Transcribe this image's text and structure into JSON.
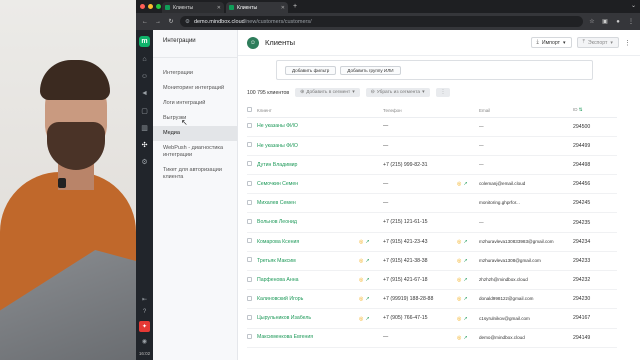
{
  "browser": {
    "tabs": [
      {
        "label": "Клиенты",
        "active": false
      },
      {
        "label": "Клиенты",
        "active": true
      }
    ],
    "url_host": "demo.mindbox.cloud",
    "url_path": "/new/customers/customers/"
  },
  "rail": {
    "logo": "m",
    "bottom_time": "16:02"
  },
  "submenu": {
    "title": "Интеграции",
    "items": [
      {
        "label": "Интеграции",
        "active": false
      },
      {
        "label": "Мониторинг интеграций",
        "active": false
      },
      {
        "label": "Логи интеграций",
        "active": false
      },
      {
        "label": "Выгрузки",
        "active": false
      },
      {
        "label": "Медиа",
        "active": true
      },
      {
        "label": "WebPush - диагностика интеграции",
        "active": false
      },
      {
        "label": "Тикет для авторизации клиента",
        "active": false
      }
    ]
  },
  "page": {
    "title": "Клиенты",
    "import_label": "Импорт",
    "export_label": "Экспорт",
    "add_filter": "Добавить фильтр",
    "add_group": "Добавить группу ИЛИ",
    "count": "100 795 клиентов",
    "add_segment": "Добавить в сегмент",
    "remove_segment": "Убрать из сегмента"
  },
  "table": {
    "headers": {
      "client": "Клиент",
      "phone": "Телефон",
      "email": "Email",
      "id": "ID"
    },
    "rows": [
      {
        "name": "Не указаны ФИО",
        "icons": false,
        "phone": "—",
        "phone_icons": false,
        "email": "—",
        "id": "294500"
      },
      {
        "name": "Не указаны ФИО",
        "icons": false,
        "phone": "—",
        "phone_icons": false,
        "email": "—",
        "id": "294499"
      },
      {
        "name": "Дутин Владимир",
        "icons": false,
        "phone": "+7 (215) 999-82-31",
        "phone_icons": false,
        "email": "—",
        "id": "294498"
      },
      {
        "name": "Семочкин Семен",
        "icons": false,
        "phone": "—",
        "phone_icons": true,
        "email": "colemanj@email.cloud",
        "id": "294456"
      },
      {
        "name": "Михалев Семен",
        "icons": false,
        "phone": "—",
        "phone_icons": false,
        "email": "monitoring.ghprfor...",
        "id": "294245"
      },
      {
        "name": "Вольнов Леонид",
        "icons": false,
        "phone": "+7 (215) 121-61-15",
        "phone_icons": false,
        "email": "—",
        "id": "294235"
      },
      {
        "name": "Комарова Ксения",
        "icons": true,
        "phone": "+7 (915) 421-23-43",
        "phone_icons": true,
        "email": "mzhuravleva130833983@gmail.com",
        "id": "294234"
      },
      {
        "name": "Третьяк Максим",
        "icons": true,
        "phone": "+7 (915) 421-38-38",
        "phone_icons": true,
        "email": "mzhuravleva1308@gmail.com",
        "id": "294233"
      },
      {
        "name": "Парфенова Анна",
        "icons": true,
        "phone": "+7 (915) 421-67-18",
        "phone_icons": true,
        "email": "zhzhzh@mindbox.cloud",
        "id": "294232"
      },
      {
        "name": "Калиновский Игорь",
        "icons": true,
        "phone": "+7 (99919) 188-28-88",
        "phone_icons": true,
        "email": "donald99812z@gmail.com",
        "id": "294230"
      },
      {
        "name": "Цырульников Изабель",
        "icons": true,
        "phone": "+7 (905) 766-47-15",
        "phone_icons": true,
        "email": "c1syrulnikov@gmail.com",
        "id": "294167"
      },
      {
        "name": "Максименкова Евгения",
        "icons": false,
        "phone": "—",
        "phone_icons": true,
        "email": "demo@mindbox.cloud",
        "id": "294149"
      }
    ]
  },
  "colors": {
    "accent": "#1f9a5a",
    "rail": "#21252b"
  },
  "icons": {
    "rail": [
      "home-icon",
      "users-icon",
      "megaphone-icon",
      "bag-icon",
      "chart-icon",
      "puzzle-icon",
      "gear-icon"
    ]
  }
}
